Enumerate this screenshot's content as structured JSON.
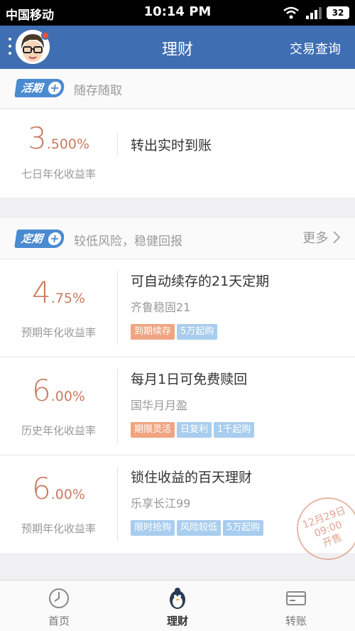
{
  "status_bar": {
    "carrier": "中国移动",
    "time": "10:14 PM",
    "battery": "32"
  },
  "navbar": {
    "title": "理财",
    "right_link": "交易查询"
  },
  "current_section": {
    "tag": "活期",
    "subtitle": "随存随取",
    "product": {
      "rate_main": "3",
      "rate_decimal": ".500%",
      "rate_label": "七日年化收益率",
      "title": "转出实时到账"
    }
  },
  "fixed_section": {
    "tag": "定期",
    "subtitle": "较低风险，稳健回报",
    "more": "更多",
    "products": [
      {
        "rate_main": "4",
        "rate_decimal": ".75%",
        "rate_label": "预期年化收益率",
        "title": "可自动续存的21天定期",
        "name": "齐鲁稳固21",
        "badges": [
          {
            "text": "到期续存",
            "color": "orange"
          },
          {
            "text": "5万起购",
            "color": "blue"
          }
        ]
      },
      {
        "rate_main": "6",
        "rate_decimal": ".00%",
        "rate_label": "历史年化收益率",
        "title": "每月1日可免费赎回",
        "name": "国华月月盈",
        "badges": [
          {
            "text": "期限灵活",
            "color": "orange"
          },
          {
            "text": "日复利",
            "color": "blue"
          },
          {
            "text": "1千起购",
            "color": "blue"
          }
        ]
      },
      {
        "rate_main": "6",
        "rate_decimal": ".00%",
        "rate_label": "预期年化收益率",
        "title": "锁住收益的百天理财",
        "name": "乐享长江99",
        "badges": [
          {
            "text": "限时抢购",
            "color": "blue"
          },
          {
            "text": "风险较低",
            "color": "blue"
          },
          {
            "text": "5万起购",
            "color": "blue"
          }
        ]
      }
    ]
  },
  "stamp": {
    "line1": "12月29日",
    "line2": "09:00",
    "line3": "开售"
  },
  "tabs": [
    {
      "label": "首页",
      "icon": "clock-icon"
    },
    {
      "label": "理财",
      "icon": "penguin-icon"
    },
    {
      "label": "转账",
      "icon": "card-icon"
    }
  ],
  "colors": {
    "nav_blue": "#3f6fb2",
    "rate_orange": "#c97a5e",
    "tag_blue": "#4a8bd0",
    "badge_orange": "#f0a481",
    "badge_blue": "#a9cdee"
  }
}
